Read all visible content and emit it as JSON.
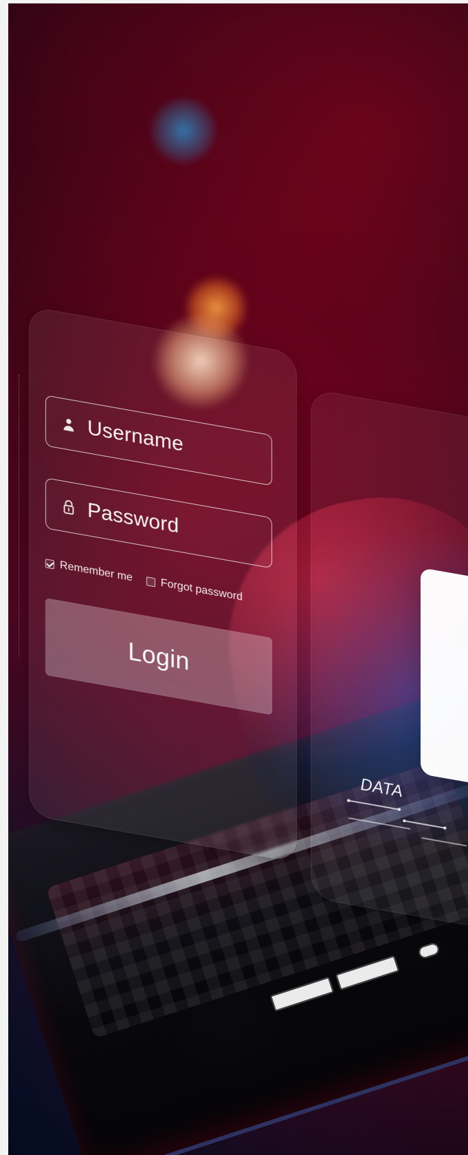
{
  "login": {
    "username_label": "Username",
    "password_label": "Password",
    "remember_me_label": "Remember me",
    "forgot_password_label": "Forgot password",
    "login_button_label": "Login",
    "remember_me_checked": true,
    "forgot_password_checked": false
  },
  "overlay": {
    "data_label": "DATA"
  },
  "icons": {
    "user": "user-icon",
    "lock": "lock-icon",
    "checkbox_checked": "checkbox-checked-icon",
    "checkbox_unchecked": "checkbox-unchecked-icon"
  }
}
